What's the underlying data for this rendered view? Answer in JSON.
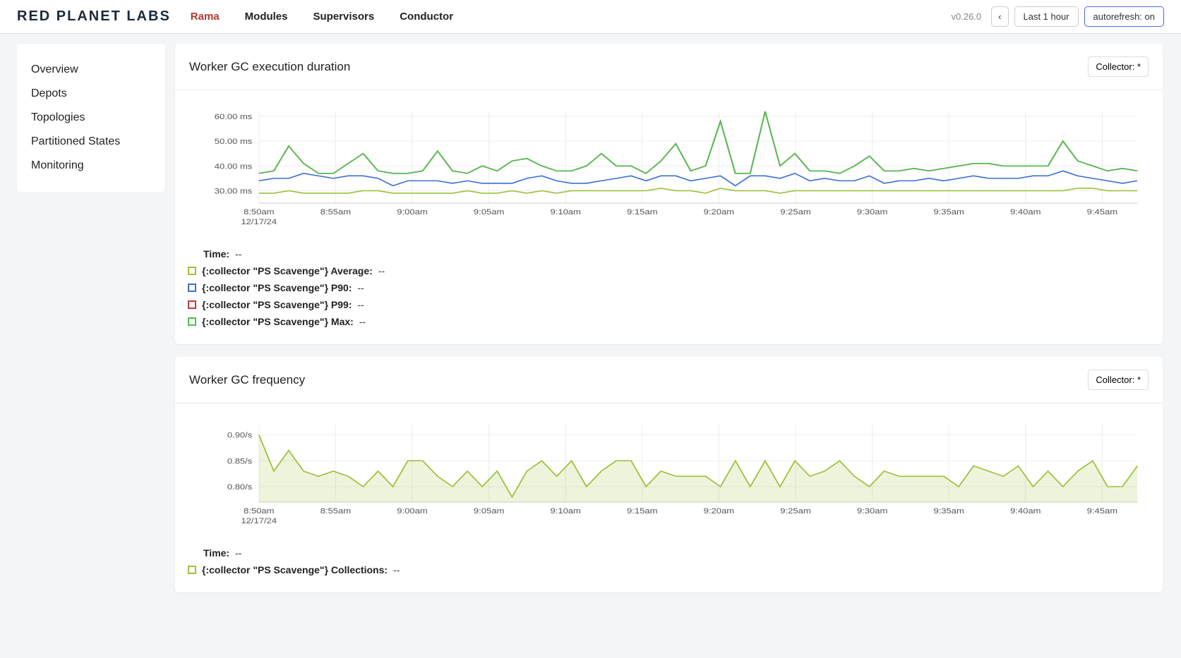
{
  "header": {
    "logo": "RED PLANET LABS",
    "nav": [
      {
        "label": "Rama",
        "active": true
      },
      {
        "label": "Modules",
        "active": false
      },
      {
        "label": "Supervisors",
        "active": false
      },
      {
        "label": "Conductor",
        "active": false
      }
    ],
    "version": "v0.26.0",
    "back_icon": "‹",
    "time_range": "Last 1 hour",
    "autorefresh": "autorefresh: on"
  },
  "sidebar": {
    "items": [
      "Overview",
      "Depots",
      "Topologies",
      "Partitioned States",
      "Monitoring"
    ]
  },
  "cards": {
    "gc_duration": {
      "title": "Worker GC execution duration",
      "collector_btn": "Collector: *",
      "time_label": "Time:",
      "time_value": "--",
      "legend": [
        {
          "color": "#9ec13c",
          "label": "{:collector \"PS Scavenge\"} Average:",
          "value": "--"
        },
        {
          "color": "#3b6fd6",
          "label": "{:collector \"PS Scavenge\"} P90:",
          "value": "--"
        },
        {
          "color": "#c23b3b",
          "label": "{:collector \"PS Scavenge\"} P99:",
          "value": "--"
        },
        {
          "color": "#4fbf4f",
          "label": "{:collector \"PS Scavenge\"} Max:",
          "value": "--"
        }
      ]
    },
    "gc_frequency": {
      "title": "Worker GC frequency",
      "collector_btn": "Collector: *",
      "time_label": "Time:",
      "time_value": "--",
      "legend": [
        {
          "color": "#9ec13c",
          "label": "{:collector \"PS Scavenge\"} Collections:",
          "value": "--"
        }
      ]
    }
  },
  "chart_data": [
    {
      "type": "line",
      "title": "Worker GC execution duration",
      "xlabel": "",
      "ylabel": "ms",
      "ylim": [
        25,
        62
      ],
      "y_ticks": [
        "30.00 ms",
        "40.00 ms",
        "50.00 ms",
        "60.00 ms"
      ],
      "x_ticks": [
        "8:50am",
        "8:55am",
        "9:00am",
        "9:05am",
        "9:10am",
        "9:15am",
        "9:20am",
        "9:25am",
        "9:30am",
        "9:35am",
        "9:40am",
        "9:45am"
      ],
      "x_date": "12/17/24",
      "categories_index": [
        0,
        1,
        2,
        3,
        4,
        5,
        6,
        7,
        8,
        9,
        10,
        11,
        12,
        13,
        14,
        15,
        16,
        17,
        18,
        19,
        20,
        21,
        22,
        23,
        24,
        25,
        26,
        27,
        28,
        29,
        30,
        31,
        32,
        33,
        34,
        35,
        36,
        37,
        38,
        39,
        40,
        41,
        42,
        43,
        44,
        45,
        46,
        47,
        48,
        49,
        50,
        51,
        52,
        53,
        54,
        55,
        56,
        57,
        58,
        59
      ],
      "series": [
        {
          "name": "{:collector \"PS Scavenge\"} Average",
          "color": "#9ec13c",
          "values": [
            29,
            29,
            30,
            29,
            29,
            29,
            29,
            30,
            30,
            29,
            29,
            29,
            29,
            29,
            30,
            29,
            29,
            30,
            29,
            30,
            29,
            30,
            30,
            30,
            30,
            30,
            30,
            31,
            30,
            30,
            29,
            31,
            30,
            30,
            30,
            29,
            30,
            30,
            30,
            30,
            30,
            30,
            30,
            30,
            30,
            30,
            30,
            30,
            30,
            30,
            30,
            30,
            30,
            30,
            30,
            31,
            31,
            30,
            30,
            30
          ]
        },
        {
          "name": "{:collector \"PS Scavenge\"} P90",
          "color": "#3b6fd6",
          "values": [
            34,
            35,
            35,
            37,
            36,
            35,
            36,
            36,
            35,
            32,
            34,
            34,
            34,
            33,
            34,
            33,
            33,
            33,
            35,
            36,
            34,
            33,
            33,
            34,
            35,
            36,
            34,
            36,
            36,
            34,
            35,
            36,
            32,
            36,
            36,
            35,
            37,
            34,
            35,
            34,
            34,
            36,
            33,
            34,
            34,
            35,
            34,
            35,
            36,
            35,
            35,
            35,
            36,
            36,
            38,
            36,
            35,
            34,
            33,
            34
          ]
        },
        {
          "name": "{:collector \"PS Scavenge\"} P99",
          "color": "#c23b3b",
          "values": [
            37,
            38,
            48,
            41,
            37,
            37,
            41,
            45,
            38,
            37,
            37,
            38,
            46,
            38,
            37,
            40,
            38,
            42,
            43,
            40,
            38,
            38,
            40,
            45,
            40,
            40,
            37,
            42,
            49,
            38,
            40,
            58,
            37,
            37,
            62,
            40,
            45,
            38,
            38,
            37,
            40,
            44,
            38,
            38,
            39,
            38,
            39,
            40,
            41,
            41,
            40,
            40,
            40,
            40,
            50,
            42,
            40,
            38,
            39,
            38
          ]
        },
        {
          "name": "{:collector \"PS Scavenge\"} Max",
          "color": "#4fbf4f",
          "values": [
            37,
            38,
            48,
            41,
            37,
            37,
            41,
            45,
            38,
            37,
            37,
            38,
            46,
            38,
            37,
            40,
            38,
            42,
            43,
            40,
            38,
            38,
            40,
            45,
            40,
            40,
            37,
            42,
            49,
            38,
            40,
            58,
            37,
            37,
            62,
            40,
            45,
            38,
            38,
            37,
            40,
            44,
            38,
            38,
            39,
            38,
            39,
            40,
            41,
            41,
            40,
            40,
            40,
            40,
            50,
            42,
            40,
            38,
            39,
            38
          ]
        }
      ]
    },
    {
      "type": "area",
      "title": "Worker GC frequency",
      "xlabel": "",
      "ylabel": "/s",
      "ylim": [
        0.77,
        0.92
      ],
      "y_ticks": [
        "0.80/s",
        "0.85/s",
        "0.90/s"
      ],
      "x_ticks": [
        "8:50am",
        "8:55am",
        "9:00am",
        "9:05am",
        "9:10am",
        "9:15am",
        "9:20am",
        "9:25am",
        "9:30am",
        "9:35am",
        "9:40am",
        "9:45am"
      ],
      "x_date": "12/17/24",
      "categories_index": [
        0,
        1,
        2,
        3,
        4,
        5,
        6,
        7,
        8,
        9,
        10,
        11,
        12,
        13,
        14,
        15,
        16,
        17,
        18,
        19,
        20,
        21,
        22,
        23,
        24,
        25,
        26,
        27,
        28,
        29,
        30,
        31,
        32,
        33,
        34,
        35,
        36,
        37,
        38,
        39,
        40,
        41,
        42,
        43,
        44,
        45,
        46,
        47,
        48,
        49,
        50,
        51,
        52,
        53,
        54,
        55,
        56,
        57,
        58,
        59
      ],
      "series": [
        {
          "name": "{:collector \"PS Scavenge\"} Collections",
          "color": "#9ec13c",
          "values": [
            0.9,
            0.83,
            0.87,
            0.83,
            0.82,
            0.83,
            0.82,
            0.8,
            0.83,
            0.8,
            0.85,
            0.85,
            0.82,
            0.8,
            0.83,
            0.8,
            0.83,
            0.78,
            0.83,
            0.85,
            0.82,
            0.85,
            0.8,
            0.83,
            0.85,
            0.85,
            0.8,
            0.83,
            0.82,
            0.82,
            0.82,
            0.8,
            0.85,
            0.8,
            0.85,
            0.8,
            0.85,
            0.82,
            0.83,
            0.85,
            0.82,
            0.8,
            0.83,
            0.82,
            0.82,
            0.82,
            0.82,
            0.8,
            0.84,
            0.83,
            0.82,
            0.84,
            0.8,
            0.83,
            0.8,
            0.83,
            0.85,
            0.8,
            0.8,
            0.84
          ]
        }
      ]
    }
  ]
}
